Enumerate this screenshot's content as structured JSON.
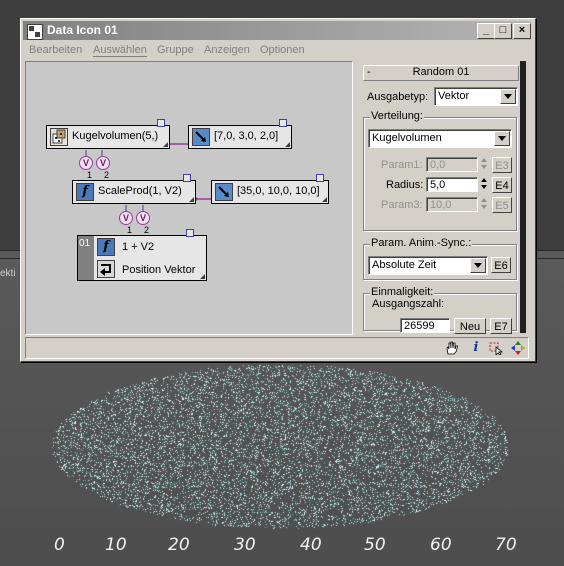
{
  "window": {
    "title": "Data Icon 01"
  },
  "menu": [
    "Bearbeiten",
    "Auswählen",
    "Gruppe",
    "Anzeigen",
    "Optionen"
  ],
  "nodes": {
    "kugelvolumen": "Kugelvolumen(5,)",
    "vector1": "[7,0, 3,0, 2,0]",
    "scaleprod": "ScaleProd(1, V2)",
    "vector2": "[35,0, 10,0, 10,0]",
    "plus_line1": "1 + V2",
    "plus_line2": "Position Vektor",
    "plus_index": "01"
  },
  "ports": {
    "v": "V",
    "n1": "1",
    "n2": "2"
  },
  "panel": {
    "rollout_title": "Random 01",
    "rollout_toggle": "-",
    "ausgabetyp_label": "Ausgabetyp:",
    "ausgabetyp_value": "Vektor",
    "verteilung_title": "Verteilung:",
    "verteilung_value": "Kugelvolumen",
    "param1_label": "Param1:",
    "param1_value": "0,0",
    "param1_btn": "E3",
    "radius_label": "Radius:",
    "radius_value": "5,0",
    "radius_btn": "E4",
    "param3_label": "Param3:",
    "param3_value": "10,0",
    "param3_btn": "E5",
    "sync_title": "Param. Anim.-Sync.:",
    "sync_value": "Absolute Zeit",
    "sync_btn": "E6",
    "einmaligkeit_title": "Einmaligkeit:",
    "ausgangszahl_label": "Ausgangszahl:",
    "ausgangszahl_value": "26599",
    "neu_btn": "Neu",
    "ausgangszahl_btn": "E7"
  },
  "status_icons": [
    "hand-icon",
    "info-icon",
    "select-icon",
    "move-icon"
  ],
  "viewport": {
    "label": "ekti",
    "ruler": [
      "0",
      "10",
      "20",
      "30",
      "40",
      "50",
      "60",
      "70"
    ]
  }
}
